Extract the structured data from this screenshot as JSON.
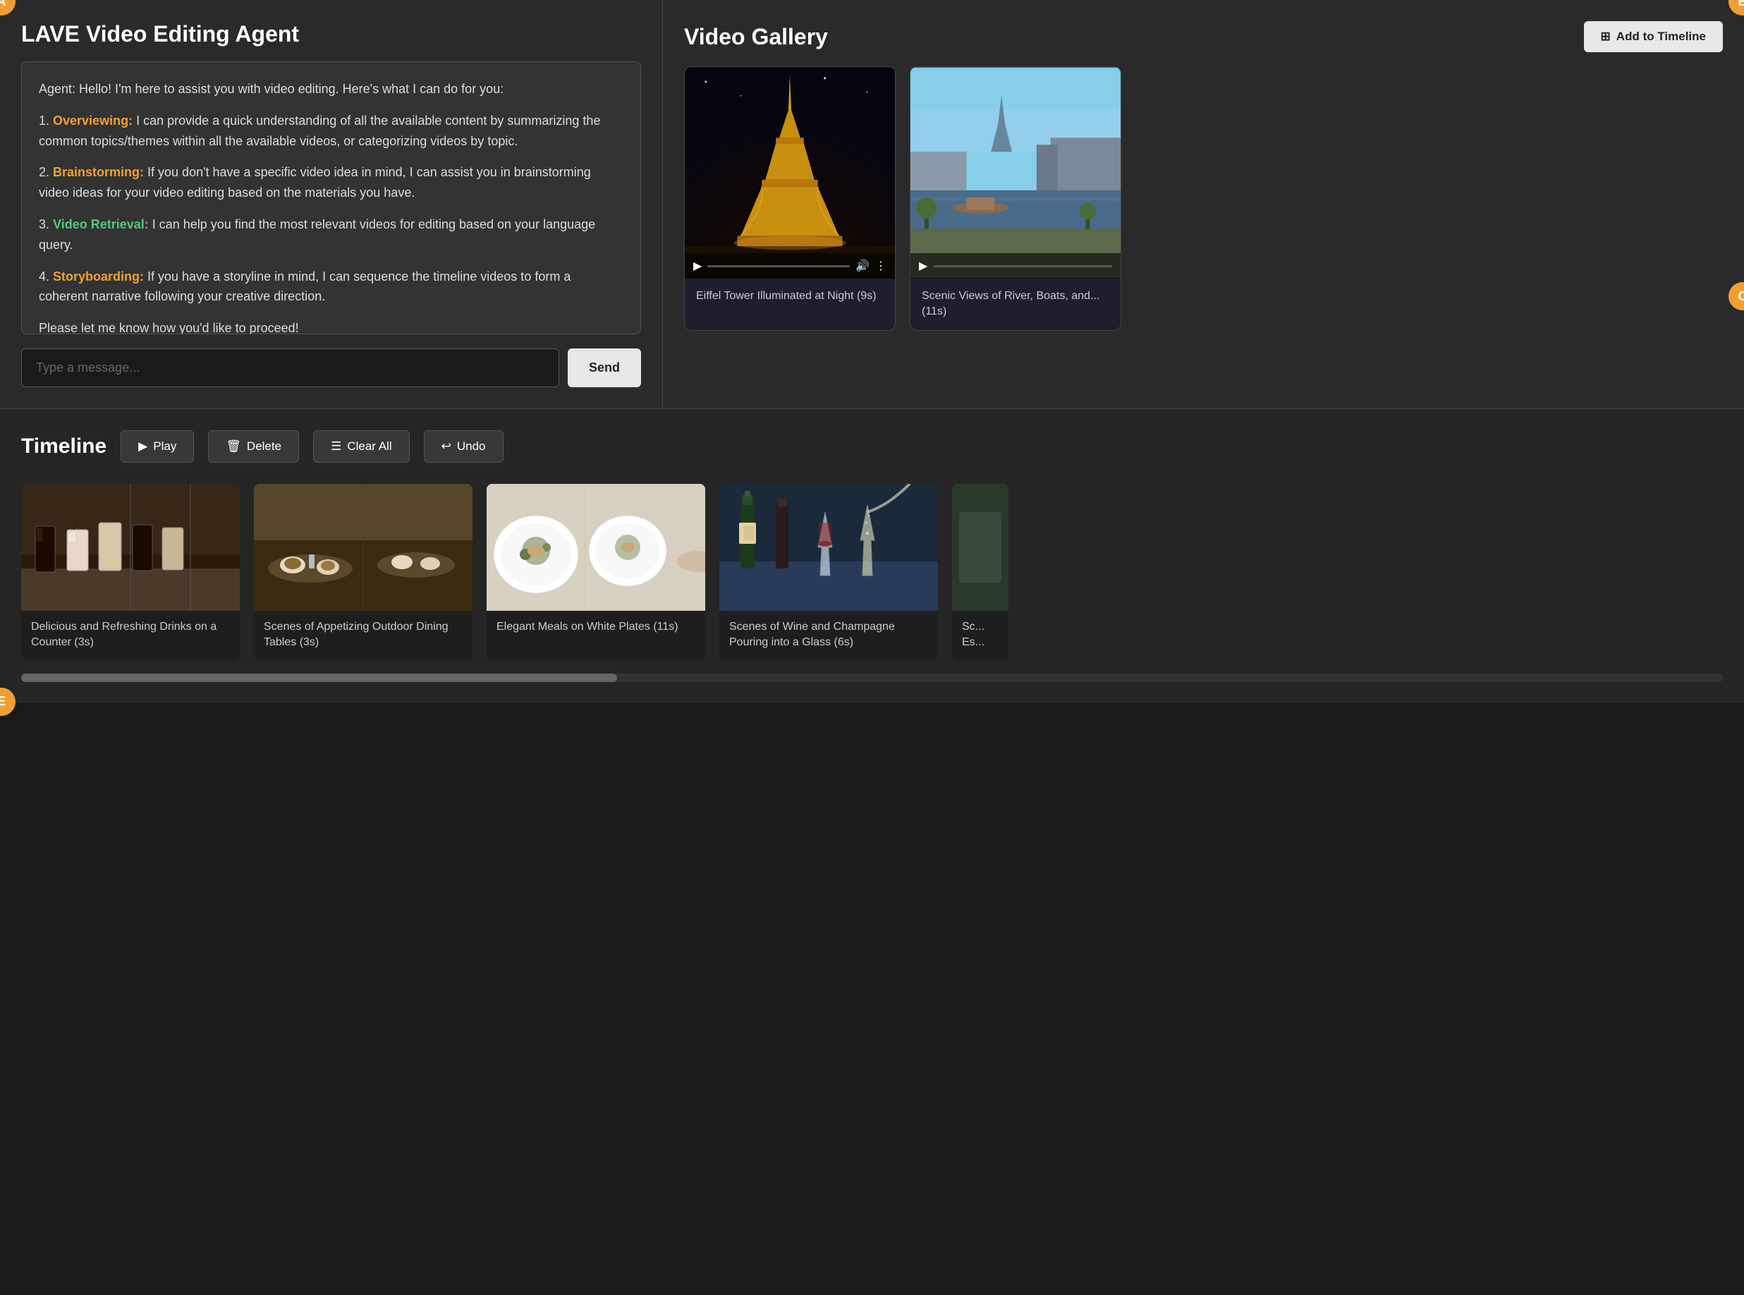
{
  "app": {
    "title": "LAVE Video Editing Agent",
    "badges": {
      "a": "A",
      "b": "B",
      "c": "C",
      "e": "E"
    }
  },
  "chat": {
    "intro": "Agent: Hello! I'm here to assist you with video editing. Here's what I can do for you:",
    "features": [
      {
        "id": 1,
        "label": "Overviewing:",
        "text": " I can provide a quick understanding of all the available content by summarizing the common topics/themes within all the available videos, or categorizing videos by topic."
      },
      {
        "id": 2,
        "label": "Brainstorming:",
        "text": " If you don't have a specific video idea in mind, I can assist you in brainstorming video ideas for your video editing based on the materials you have."
      },
      {
        "id": 3,
        "label": "Video Retrieval:",
        "text": " I can help you find the most relevant videos for editing based on your language query."
      },
      {
        "id": 4,
        "label": "Storyboarding:",
        "text": " If you have a storyline in mind, I can sequence the timeline videos to form a coherent narrative following your creative direction."
      }
    ],
    "outro": "Please let me know how you'd like to proceed!",
    "input_placeholder": "Type a message...",
    "send_label": "Send"
  },
  "gallery": {
    "title": "Video Gallery",
    "add_timeline_label": "Add to Timeline",
    "videos": [
      {
        "id": 1,
        "title": "Eiffel Tower Illuminated at Night (9s)",
        "type": "eiffel"
      },
      {
        "id": 2,
        "title": "Scenic Views of River, Boats, and... (11s)",
        "type": "paris_river"
      }
    ]
  },
  "timeline": {
    "title": "Timeline",
    "buttons": {
      "play": "Play",
      "delete": "Delete",
      "clear_all": "Clear All",
      "undo": "Undo"
    },
    "clips": [
      {
        "id": 1,
        "title": "Delicious and Refreshing Drinks on a Counter (3s)",
        "type": "drinks"
      },
      {
        "id": 2,
        "title": "Scenes of Appetizing Outdoor Dining Tables (3s)",
        "type": "outdoor"
      },
      {
        "id": 3,
        "title": "Elegant Meals on White Plates (11s)",
        "type": "meals"
      },
      {
        "id": 4,
        "title": "Scenes of Wine and Champagne Pouring into a Glass (6s)",
        "type": "wine"
      },
      {
        "id": 5,
        "title": "Sc... Es...",
        "type": "fifth"
      }
    ]
  }
}
